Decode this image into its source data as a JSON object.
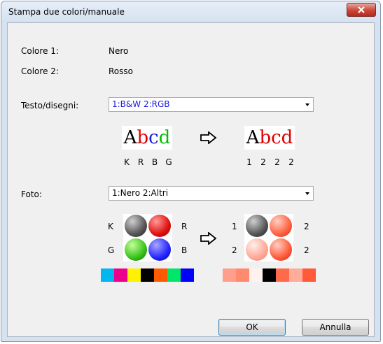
{
  "window": {
    "title": "Stampa due colori/manuale"
  },
  "colors": {
    "color1_label": "Colore 1:",
    "color1_value": "Nero",
    "color2_label": "Colore 2:",
    "color2_value": "Rosso"
  },
  "text_drawing": {
    "label": "Testo/disegni:",
    "selected": "1:B&W 2:RGB",
    "sample_text": "Abcd",
    "left_letters": [
      "K",
      "R",
      "B",
      "G"
    ],
    "right_letters": [
      "1",
      "2",
      "2",
      "2"
    ]
  },
  "photo": {
    "label": "Foto:",
    "selected": "1:Nero 2:Altri",
    "left_labels": {
      "tl": "K",
      "tr": "R",
      "bl": "G",
      "br": "B"
    },
    "right_labels": {
      "tl": "1",
      "tr": "2",
      "bl": "2",
      "br": "2"
    },
    "left_swatches": [
      "#00b7ef",
      "#ec008c",
      "#fff200",
      "#000000",
      "#ff5a00",
      "#00e66b",
      "#0000ff"
    ],
    "right_swatches": [
      "#ff9e8a",
      "#ff8a70",
      "#fff2ee",
      "#000000",
      "#ff6a4a",
      "#ffad9a",
      "#ff5a3a"
    ]
  },
  "buttons": {
    "ok": "OK",
    "cancel": "Annulla"
  },
  "accent": {
    "text_color": "#1a1ae0"
  }
}
